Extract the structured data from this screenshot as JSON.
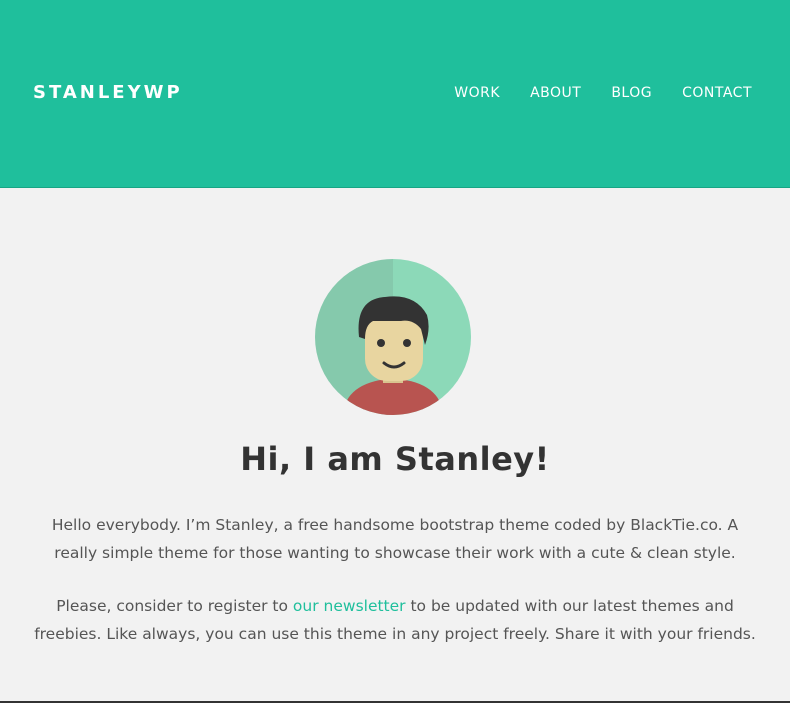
{
  "header": {
    "brand": "STANLEYWP",
    "nav": [
      "WORK",
      "ABOUT",
      "BLOG",
      "CONTACT"
    ]
  },
  "hero": {
    "title": "Hi, I am Stanley!",
    "paragraph1": "Hello everybody. I’m Stanley, a free handsome bootstrap theme coded by BlackTie.co. A really simple theme for those wanting to showcase their work with a cute & clean style.",
    "paragraph2_before": "Please, consider to register to ",
    "paragraph2_link": "our newsletter",
    "paragraph2_after": " to be updated with our latest themes and freebies. Like always, you can use this theme in any project freely. Share it with your friends."
  },
  "colors": {
    "header_bg": "#1fbf9c",
    "page_bg": "#f2f2f2",
    "link": "#1fbf9c",
    "avatar_left": "#85c9ac",
    "avatar_right": "#8cd9b8",
    "shirt": "#b85450",
    "skin": "#e8d5a0",
    "hair": "#333333"
  },
  "icons": {
    "avatar": "avatar-illustration"
  }
}
